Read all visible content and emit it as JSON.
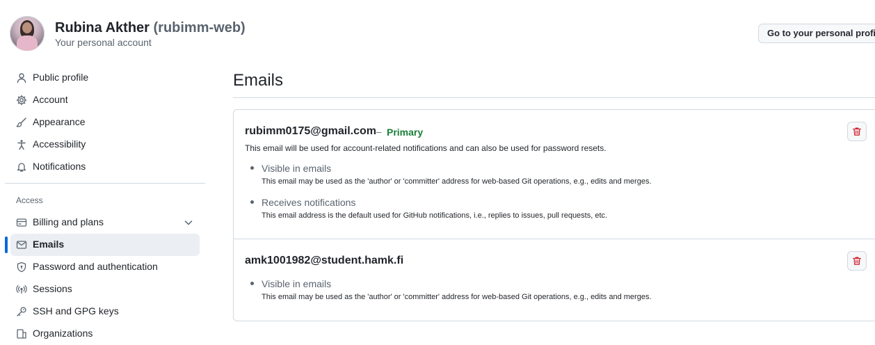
{
  "header": {
    "display_name": "Rubina Akther",
    "login": "(rubimm-web)",
    "subtitle": "Your personal account",
    "profile_button": "Go to your personal profile"
  },
  "sidebar": {
    "items": [
      {
        "label": "Public profile",
        "icon": "person-icon"
      },
      {
        "label": "Account",
        "icon": "gear-icon"
      },
      {
        "label": "Appearance",
        "icon": "paintbrush-icon"
      },
      {
        "label": "Accessibility",
        "icon": "accessibility-icon"
      },
      {
        "label": "Notifications",
        "icon": "bell-icon"
      }
    ],
    "section_label": "Access",
    "access_items": [
      {
        "label": "Billing and plans",
        "icon": "credit-card-icon"
      },
      {
        "label": "Emails",
        "icon": "mail-icon"
      },
      {
        "label": "Password and authentication",
        "icon": "shield-lock-icon"
      },
      {
        "label": "Sessions",
        "icon": "broadcast-icon"
      },
      {
        "label": "SSH and GPG keys",
        "icon": "key-icon"
      },
      {
        "label": "Organizations",
        "icon": "organization-icon"
      }
    ]
  },
  "main": {
    "title": "Emails",
    "emails": [
      {
        "address": "rubimm0175@gmail.com",
        "separator": "–",
        "badge": "Primary",
        "description": "This email will be used for account-related notifications and can also be used for password resets.",
        "bullets": [
          {
            "title": "Visible in emails",
            "text": "This email may be used as the 'author' or 'committer' address for web-based Git operations, e.g., edits and merges."
          },
          {
            "title": "Receives notifications",
            "text": "This email address is the default used for GitHub notifications, i.e., replies to issues, pull requests, etc."
          }
        ]
      },
      {
        "address": "amk1001982@student.hamk.fi",
        "bullets": [
          {
            "title": "Visible in emails",
            "text": "This email may be used as the 'author' or 'committer' address for web-based Git operations, e.g., edits and merges."
          }
        ]
      }
    ]
  },
  "colors": {
    "accent": "#0969da",
    "primary_badge": "#1a7f37",
    "danger": "#d1242f",
    "border": "#d1d9e0"
  }
}
